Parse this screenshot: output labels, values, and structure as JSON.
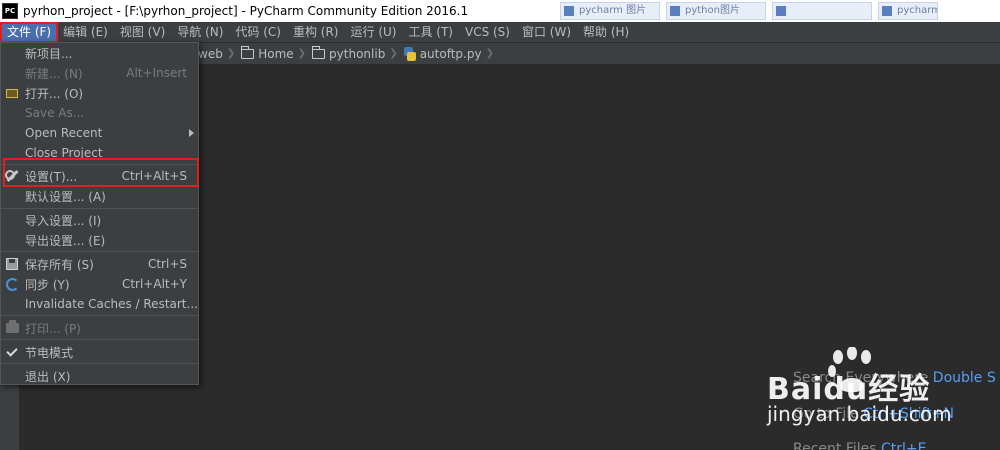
{
  "titlebar": {
    "app_icon_text": "PC",
    "title": "pyrhon_project - [F:\\pyrhon_project] - PyCharm Community Edition 2016.1",
    "taskbar_ghosts": [
      "pycharm 图片",
      "python图片",
      "",
      "pycharm"
    ]
  },
  "menubar": {
    "items": [
      {
        "label": "文件 (F)"
      },
      {
        "label": "编辑 (E)"
      },
      {
        "label": "视图 (V)"
      },
      {
        "label": "导航 (N)"
      },
      {
        "label": "代码 (C)"
      },
      {
        "label": "重构 (R)"
      },
      {
        "label": "运行 (U)"
      },
      {
        "label": "工具 (T)"
      },
      {
        "label": "VCS (S)"
      },
      {
        "label": "窗口 (W)"
      },
      {
        "label": "帮助 (H)"
      }
    ]
  },
  "breadcrumb": {
    "items": [
      {
        "label": "web",
        "icon": "folder-icon"
      },
      {
        "label": "Home",
        "icon": "folder-icon"
      },
      {
        "label": "pythonlib",
        "icon": "folder-icon"
      },
      {
        "label": "autoftp.py",
        "icon": "python-file-icon"
      }
    ]
  },
  "file_menu": {
    "items": [
      {
        "label": "新项目...",
        "shortcut": ""
      },
      {
        "label": "新建... (N)",
        "shortcut": "Alt+Insert",
        "disabled": true
      },
      {
        "label": "打开... (O)",
        "shortcut": "",
        "icon": "folder-icon"
      },
      {
        "label": "Save As...",
        "shortcut": "",
        "disabled": true
      },
      {
        "label": "Open Recent",
        "shortcut": "",
        "submenu": true
      },
      {
        "label": "Close Project",
        "shortcut": ""
      },
      {
        "label": "设置(T)...",
        "shortcut": "Ctrl+Alt+S",
        "icon": "wrench-icon"
      },
      {
        "label": "默认设置... (A)",
        "shortcut": ""
      },
      {
        "label": "导入设置... (I)",
        "shortcut": ""
      },
      {
        "label": "导出设置... (E)",
        "shortcut": ""
      },
      {
        "label": "保存所有 (S)",
        "shortcut": "Ctrl+S",
        "icon": "save-icon"
      },
      {
        "label": "同步 (Y)",
        "shortcut": "Ctrl+Alt+Y",
        "icon": "sync-icon"
      },
      {
        "label": "Invalidate Caches / Restart...",
        "shortcut": ""
      },
      {
        "label": "打印... (P)",
        "shortcut": "",
        "disabled": true,
        "icon": "print-icon"
      },
      {
        "label": "节电模式",
        "shortcut": "",
        "icon": "check-icon",
        "checked": true
      },
      {
        "label": "退出 (X)",
        "shortcut": ""
      }
    ]
  },
  "editor_hints": {
    "search_everywhere": {
      "label": "Search Everywhere",
      "key": "Double S"
    },
    "goto_file": {
      "label": "Go to File",
      "key": "Ctrl+Shift+N"
    },
    "recent_files": {
      "label": "Recent Files",
      "key": "Ctrl+E"
    }
  },
  "watermark": {
    "brand": "Baidu经验",
    "url": "jingyan.baidu.com"
  },
  "colors": {
    "accent": "#4b6eaf",
    "highlight_box": "#e02020",
    "link": "#589df6"
  }
}
